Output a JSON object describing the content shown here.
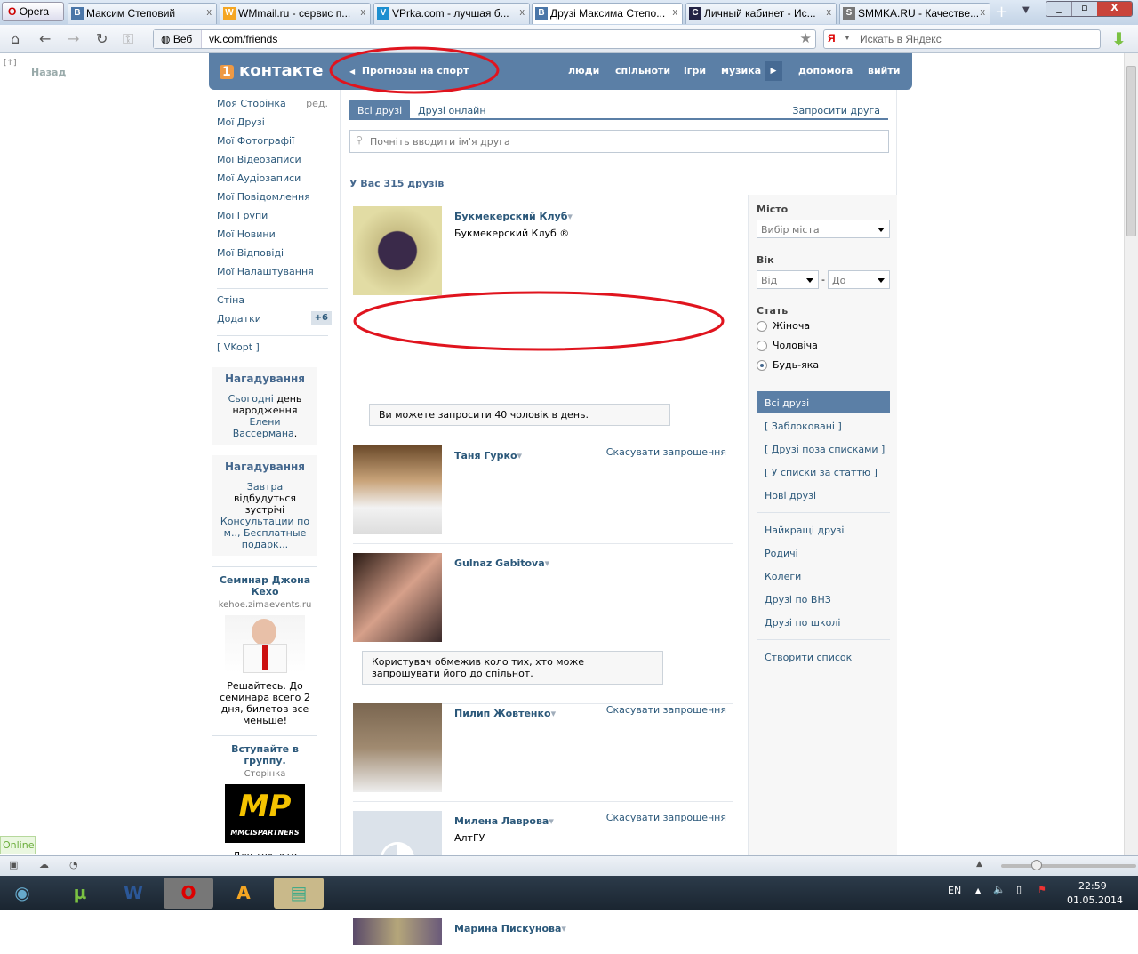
{
  "browser": {
    "opera_label": "Opera",
    "tabs": [
      {
        "label": "Максим Степовий",
        "icon": "B"
      },
      {
        "label": "WMmail.ru - сервис п...",
        "icon": "W"
      },
      {
        "label": "VPrka.com - лучшая б...",
        "icon": "V"
      },
      {
        "label": "Друзі Максима Степо...",
        "icon": "B"
      },
      {
        "label": "Личный кабинет - Ис...",
        "icon": "C"
      },
      {
        "label": "SMMKA.RU - Качестве...",
        "icon": "S"
      }
    ],
    "close": "x",
    "web_label": "Веб",
    "url": "vk.com/friends",
    "search_placeholder": "Искать в Яндекс",
    "back_label": "Назад"
  },
  "header": {
    "logo": "контакте",
    "back_link": "Прогнозы на спорт",
    "nav": [
      "люди",
      "спільноти",
      "ігри",
      "музика",
      "допомога",
      "вийти"
    ]
  },
  "left_menu": {
    "items": [
      "Моя Сторінка",
      "Мої Друзі",
      "Мої Фотографії",
      "Мої Відеозаписи",
      "Мої Аудіозаписи",
      "Мої Повідомлення",
      "Мої Групи",
      "Мої Новини",
      "Мої Відповіді",
      "Мої Налаштування"
    ],
    "edit": "ред.",
    "wall": "Стіна",
    "apps": "Додатки",
    "apps_badge": "+6",
    "vkopt": "[ VKopt ]"
  },
  "reminders": [
    {
      "title": "Нагадування",
      "parts": [
        "Сьогодні",
        "день народження",
        "Елени Вассермана",
        "."
      ]
    },
    {
      "title": "Нагадування",
      "parts": [
        "Завтра",
        "відбудуться зустрічі",
        "Консультации по м..,",
        "Бесплатные подарк..."
      ]
    }
  ],
  "ads": [
    {
      "title": "Семинар Джона Кехо",
      "domain": "kehoe.zimaevents.ru",
      "text": "Решайтесь. До семинара всего 2 дня, билетов все меньше!"
    },
    {
      "title": "Вступайте в группу.",
      "domain": "Сторінка",
      "logo_text": "MMCISPARTNERS",
      "text": "Для тех, кто зарабатывает в"
    }
  ],
  "main": {
    "tabs": [
      "Всі друзі",
      "Друзі онлайн"
    ],
    "invite": "Запросити друга",
    "search_placeholder": "Почніть вводити ім'я друга",
    "count": "У Вас 315 друзів",
    "cancel": "Скасувати запрошення",
    "friends": [
      {
        "name": "Букмекерский Клуб",
        "sub": "Букмекерский Клуб ®"
      },
      {
        "name": "Таня Гурко",
        "sub": ""
      },
      {
        "name": "Gulnaz Gabitova",
        "sub": ""
      },
      {
        "name": "Пилип Жовтенко",
        "sub": ""
      },
      {
        "name": "Милена Лаврова",
        "sub": "АлтГУ"
      },
      {
        "name": "Марина Пискунова",
        "sub": ""
      }
    ],
    "note1": "Ви можете запросити 40 чоловік в день.",
    "note2": "Користувач обмежив коло тих, хто може запрошувати його до спільнот."
  },
  "filters": {
    "city_label": "Місто",
    "city_value": "Вибір міста",
    "age_label": "Вік",
    "age_from": "Від",
    "age_to": "До",
    "dash": "-",
    "sex_label": "Стать",
    "sex_options": [
      "Жіноча",
      "Чоловіча",
      "Будь-яка"
    ],
    "sex_selected": 2,
    "lists": [
      "Всі друзі",
      "[ Заблоковані ]",
      "[ Друзі поза списками ]",
      "[ У списки за статтю ]",
      "Нові друзі"
    ],
    "lists2": [
      "Найкращі друзі",
      "Родичі",
      "Колеги",
      "Друзі по ВНЗ",
      "Друзі по школі"
    ],
    "create": "Створити список"
  },
  "online": "Online",
  "taskbar": {
    "lang": "EN",
    "time": "22:59",
    "date": "01.05.2014"
  },
  "colors": {
    "vk_blue": "#5b7fa6",
    "link": "#2b587a",
    "annotation": "#e0141e"
  }
}
